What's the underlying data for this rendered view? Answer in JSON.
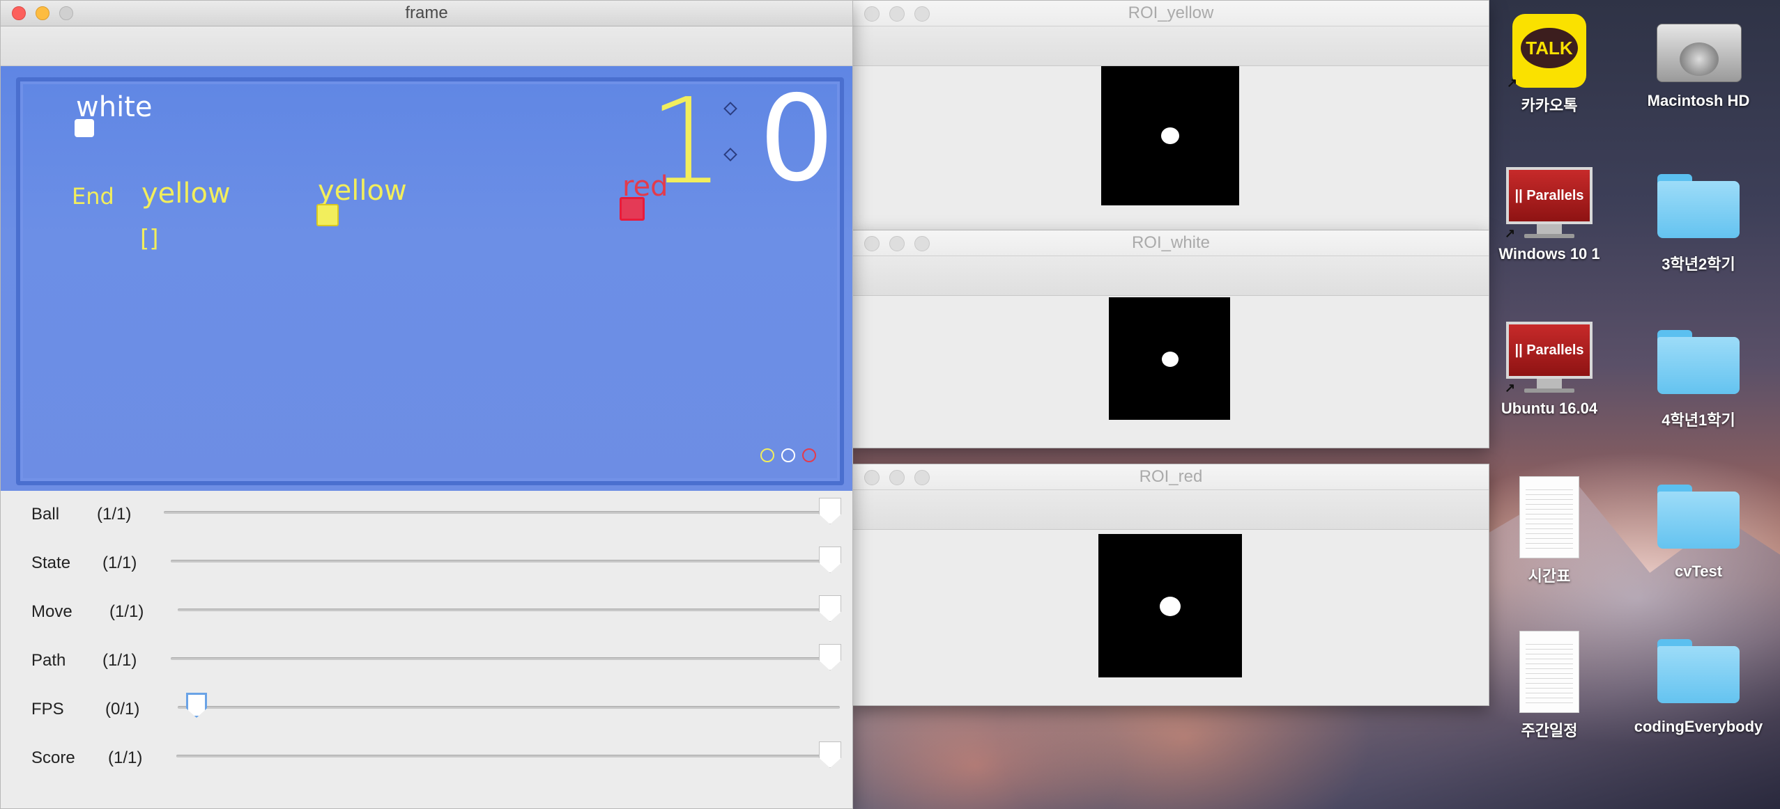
{
  "frame_window": {
    "title": "frame",
    "overlay": {
      "white_label": "white",
      "end_label": "End",
      "yellow_label_1": "yellow",
      "yellow_label_2": "yellow",
      "red_label": "red",
      "brackets": "[]",
      "score_left": "1",
      "score_right": "0"
    },
    "colors": {
      "yellow": "#f2ee5c",
      "white": "#ffffff",
      "red": "#e33b4c",
      "table_blue": "#6a8de6"
    },
    "trackbars": [
      {
        "name": "Ball",
        "count": "(1/1)",
        "value": 1.0
      },
      {
        "name": "State",
        "count": "(1/1)",
        "value": 1.0
      },
      {
        "name": "Move",
        "count": "(1/1)",
        "value": 1.0
      },
      {
        "name": "Path",
        "count": "(1/1)",
        "value": 1.0
      },
      {
        "name": "FPS",
        "count": "(0/1)",
        "value": 0.0
      },
      {
        "name": "Score",
        "count": "(1/1)",
        "value": 1.0
      }
    ]
  },
  "roi_windows": [
    {
      "title": "ROI_yellow"
    },
    {
      "title": "ROI_white"
    },
    {
      "title": "ROI_red"
    }
  ],
  "desktop_icons": [
    {
      "label": "카카오톡",
      "icon": "kakaotalk-icon",
      "badge": "TALK"
    },
    {
      "label": "Macintosh HD",
      "icon": "hard-drive-icon"
    },
    {
      "label": "Windows 10 1",
      "icon": "parallels-vm-icon",
      "badge": "|| Parallels"
    },
    {
      "label": "3학년2학기",
      "icon": "folder-icon"
    },
    {
      "label": "Ubuntu 16.04",
      "icon": "parallels-vm-icon",
      "badge": "|| Parallels"
    },
    {
      "label": "4학년1학기",
      "icon": "folder-icon"
    },
    {
      "label": "시간표",
      "icon": "document-icon"
    },
    {
      "label": "cvTest",
      "icon": "folder-icon"
    },
    {
      "label": "주간일정",
      "icon": "document-icon"
    },
    {
      "label": "codingEverybody",
      "icon": "folder-icon"
    }
  ]
}
